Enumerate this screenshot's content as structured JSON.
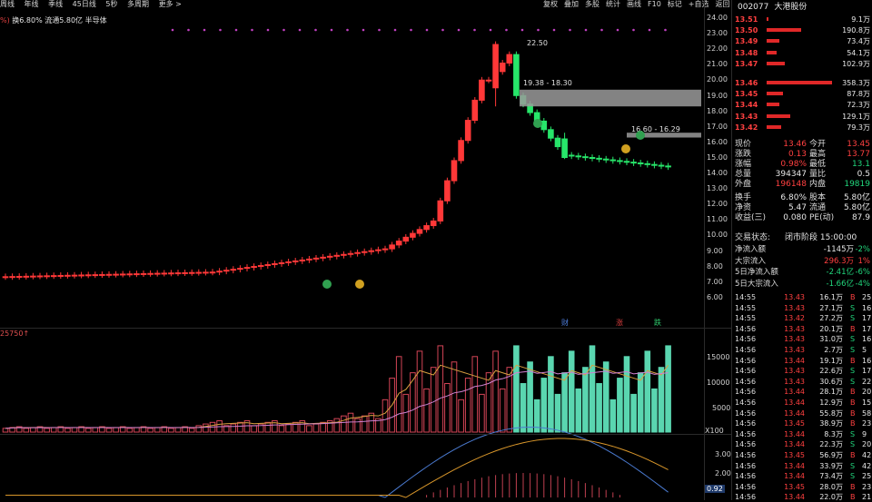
{
  "topbar": {
    "periods": [
      "周线",
      "年线",
      "季线",
      "45日线",
      "5秒",
      "多周期",
      "更多 >"
    ],
    "tools": [
      "复权",
      "叠加",
      "多股",
      "统计",
      "画线",
      "F10",
      "标记",
      "+自选",
      "返回"
    ]
  },
  "info": {
    "prefix": "%)",
    "text": "换6.80% 流通5.80亿 半导体"
  },
  "volume_label": "25750↑",
  "volume_ticks": [
    "15000",
    "10000",
    "5000",
    "X100"
  ],
  "macd_ticks": [
    "3.00",
    "2.00",
    "0.92"
  ],
  "price_ticks": [
    "24.00",
    "23.00",
    "22.00",
    "21.00",
    "20.00",
    "19.00",
    "18.00",
    "17.00",
    "16.00",
    "15.00",
    "14.00",
    "13.00",
    "12.00",
    "11.00",
    "10.00",
    "9.00",
    "8.00",
    "7.00",
    "6.00"
  ],
  "annotations": {
    "high": "22.50",
    "range1": "19.38 - 18.30",
    "range2": "16.60 - 16.29",
    "markers": [
      "财",
      "涨",
      "跌"
    ]
  },
  "stock": {
    "code": "002077",
    "name": "大港股份"
  },
  "orderbook": [
    {
      "price": "13.51",
      "vol": "9.1万",
      "frac": 0.03
    },
    {
      "price": "13.50",
      "vol": "190.8万",
      "frac": 0.53
    },
    {
      "price": "13.49",
      "vol": "73.4万",
      "frac": 0.2
    },
    {
      "price": "13.48",
      "vol": "54.1万",
      "frac": 0.15
    },
    {
      "price": "13.47",
      "vol": "102.9万",
      "frac": 0.28
    },
    {
      "price": "13.46",
      "vol": "358.3万",
      "frac": 1.0
    },
    {
      "price": "13.45",
      "vol": "87.8万",
      "frac": 0.25
    },
    {
      "price": "13.44",
      "vol": "72.3万",
      "frac": 0.2
    },
    {
      "price": "13.43",
      "vol": "129.1万",
      "frac": 0.36
    },
    {
      "price": "13.42",
      "vol": "79.3万",
      "frac": 0.22
    }
  ],
  "quote": [
    {
      "l": "现价",
      "v": "13.46",
      "vc": "red",
      "l2": "今开",
      "v2": "13.45",
      "v2c": "red"
    },
    {
      "l": "涨跌",
      "v": "0.13",
      "vc": "red",
      "l2": "最高",
      "v2": "13.77",
      "v2c": "red"
    },
    {
      "l": "涨幅",
      "v": "0.98%",
      "vc": "red",
      "l2": "最低",
      "v2": "13.1",
      "v2c": "green"
    },
    {
      "l": "总量",
      "v": "394347",
      "vc": "white",
      "l2": "量比",
      "v2": "0.5",
      "v2c": "white"
    },
    {
      "l": "外盘",
      "v": "196148",
      "vc": "red",
      "l2": "内盘",
      "v2": "19819",
      "v2c": "green"
    },
    {
      "l": "换手",
      "v": "6.80%",
      "vc": "white",
      "l2": "股本",
      "v2": "5.80亿",
      "v2c": "white"
    },
    {
      "l": "净资",
      "v": "5.47",
      "vc": "white",
      "l2": "流通",
      "v2": "5.80亿",
      "v2c": "white"
    },
    {
      "l": "收益(三)",
      "v": "0.080",
      "vc": "white",
      "l2": "PE(动)",
      "v2": "87.9",
      "v2c": "white"
    }
  ],
  "trade_status": {
    "label": "交易状态:",
    "value": "闭市阶段 15:00:00"
  },
  "flows": [
    {
      "l": "净流入额",
      "v": "-1145万",
      "vc": "white",
      "p": "-2%",
      "pc": "green"
    },
    {
      "l": "大宗流入",
      "v": "296.3万",
      "vc": "red",
      "p": "1%",
      "pc": "red"
    },
    {
      "l": "5日净流入额",
      "v": "-2.41亿",
      "vc": "green",
      "p": "-6%",
      "pc": "green"
    },
    {
      "l": "5日大宗流入",
      "v": "-1.66亿",
      "vc": "green",
      "p": "-4%",
      "pc": "green"
    }
  ],
  "ticks": [
    {
      "t": "14:55",
      "p": "13.43",
      "pc": "red",
      "v": "16.1万",
      "bs": "B",
      "n": "25"
    },
    {
      "t": "14:55",
      "p": "13.43",
      "pc": "red",
      "v": "27.1万",
      "bs": "S",
      "n": "16"
    },
    {
      "t": "14:55",
      "p": "13.42",
      "pc": "red",
      "v": "27.2万",
      "bs": "S",
      "n": "17"
    },
    {
      "t": "14:56",
      "p": "13.43",
      "pc": "red",
      "v": "20.1万",
      "bs": "B",
      "n": "17"
    },
    {
      "t": "14:56",
      "p": "13.43",
      "pc": "red",
      "v": "31.0万",
      "bs": "S",
      "n": "16"
    },
    {
      "t": "14:56",
      "p": "13.43",
      "pc": "red",
      "v": "2.7万",
      "bs": "S",
      "n": "5"
    },
    {
      "t": "14:56",
      "p": "13.44",
      "pc": "red",
      "v": "19.1万",
      "bs": "B",
      "n": "16"
    },
    {
      "t": "14:56",
      "p": "13.43",
      "pc": "red",
      "v": "22.6万",
      "bs": "S",
      "n": "17"
    },
    {
      "t": "14:56",
      "p": "13.43",
      "pc": "red",
      "v": "30.6万",
      "bs": "S",
      "n": "22"
    },
    {
      "t": "14:56",
      "p": "13.44",
      "pc": "red",
      "v": "28.1万",
      "bs": "B",
      "n": "20"
    },
    {
      "t": "14:56",
      "p": "13.44",
      "pc": "red",
      "v": "12.9万",
      "bs": "B",
      "n": "15"
    },
    {
      "t": "14:56",
      "p": "13.44",
      "pc": "red",
      "v": "55.8万",
      "bs": "B",
      "n": "58"
    },
    {
      "t": "14:56",
      "p": "13.45",
      "pc": "red",
      "v": "38.9万",
      "bs": "B",
      "n": "23"
    },
    {
      "t": "14:56",
      "p": "13.44",
      "pc": "red",
      "v": "8.3万",
      "bs": "S",
      "n": "9"
    },
    {
      "t": "14:56",
      "p": "13.44",
      "pc": "red",
      "v": "22.3万",
      "bs": "S",
      "n": "20"
    },
    {
      "t": "14:56",
      "p": "13.45",
      "pc": "red",
      "v": "56.9万",
      "bs": "B",
      "n": "42"
    },
    {
      "t": "14:56",
      "p": "13.44",
      "pc": "red",
      "v": "33.9万",
      "bs": "S",
      "n": "42"
    },
    {
      "t": "14:56",
      "p": "13.44",
      "pc": "red",
      "v": "73.4万",
      "bs": "S",
      "n": "25"
    },
    {
      "t": "14:56",
      "p": "13.45",
      "pc": "red",
      "v": "28.0万",
      "bs": "B",
      "n": "23"
    },
    {
      "t": "14:56",
      "p": "13.44",
      "pc": "red",
      "v": "22.0万",
      "bs": "B",
      "n": "21"
    }
  ],
  "colors": {
    "up": "#ff3838",
    "down": "#27e66a",
    "vol_up": "#d44456",
    "vol_down": "#5ad6b0",
    "ma5": "#d8a040",
    "ma10": "#d080d0",
    "grid": "#2a2a2a"
  }
}
